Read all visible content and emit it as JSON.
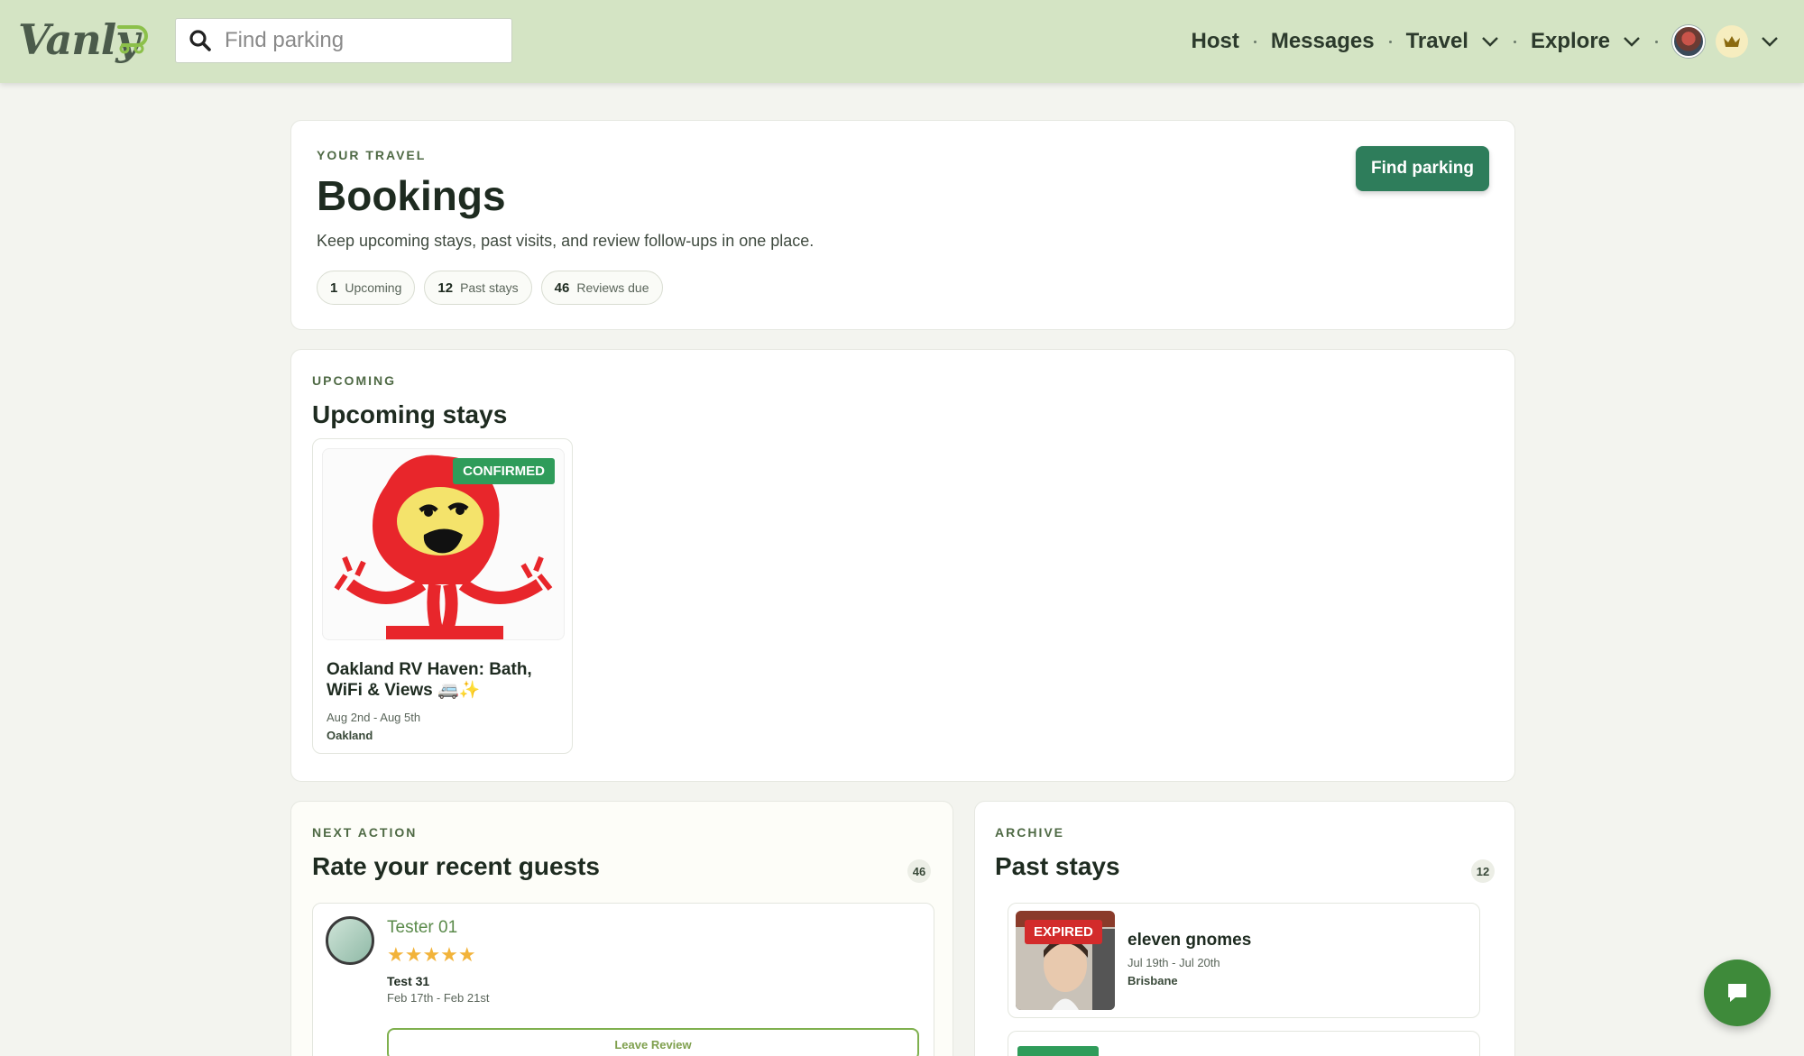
{
  "app": {
    "logo_text": "Vanly",
    "search_placeholder": "Find parking"
  },
  "nav": {
    "host": "Host",
    "messages": "Messages",
    "travel": "Travel",
    "explore": "Explore"
  },
  "bookings": {
    "eyebrow": "YOUR TRAVEL",
    "title": "Bookings",
    "description": "Keep upcoming stays, past visits, and review follow-ups in one place.",
    "cta": "Find parking",
    "chips": [
      {
        "count": "1",
        "label": "Upcoming"
      },
      {
        "count": "12",
        "label": "Past stays"
      },
      {
        "count": "46",
        "label": "Reviews due"
      }
    ]
  },
  "upcoming": {
    "eyebrow": "UPCOMING",
    "title": "Upcoming stays",
    "items": [
      {
        "status": "CONFIRMED",
        "title": "Oakland RV Haven: Bath, WiFi & Views 🚐✨",
        "dates": "Aug 2nd - Aug 5th",
        "location": "Oakland"
      }
    ]
  },
  "next_action": {
    "eyebrow": "NEXT ACTION",
    "title": "Rate your recent guests",
    "count": "46",
    "items": [
      {
        "guest": "Tester 01",
        "rating": 5,
        "stars": "★★★★★",
        "stay": "Test 31",
        "dates": "Feb 17th - Feb 21st",
        "button": "Leave Review"
      }
    ]
  },
  "archive": {
    "eyebrow": "ARCHIVE",
    "title": "Past stays",
    "count": "12",
    "items": [
      {
        "status": "EXPIRED",
        "title": "eleven gnomes",
        "dates": "Jul 19th - Jul 20th",
        "location": "Brisbane"
      }
    ]
  },
  "colors": {
    "nav_bg": "#d4e4c4",
    "primary": "#2e7d5b",
    "confirmed": "#2f9c5a",
    "expired": "#d32b2b",
    "star": "#f2b33a",
    "fab": "#3e8a3a"
  },
  "icons": [
    "search-icon",
    "chevron-down-icon",
    "avatar",
    "crown-icon",
    "chat-icon"
  ]
}
